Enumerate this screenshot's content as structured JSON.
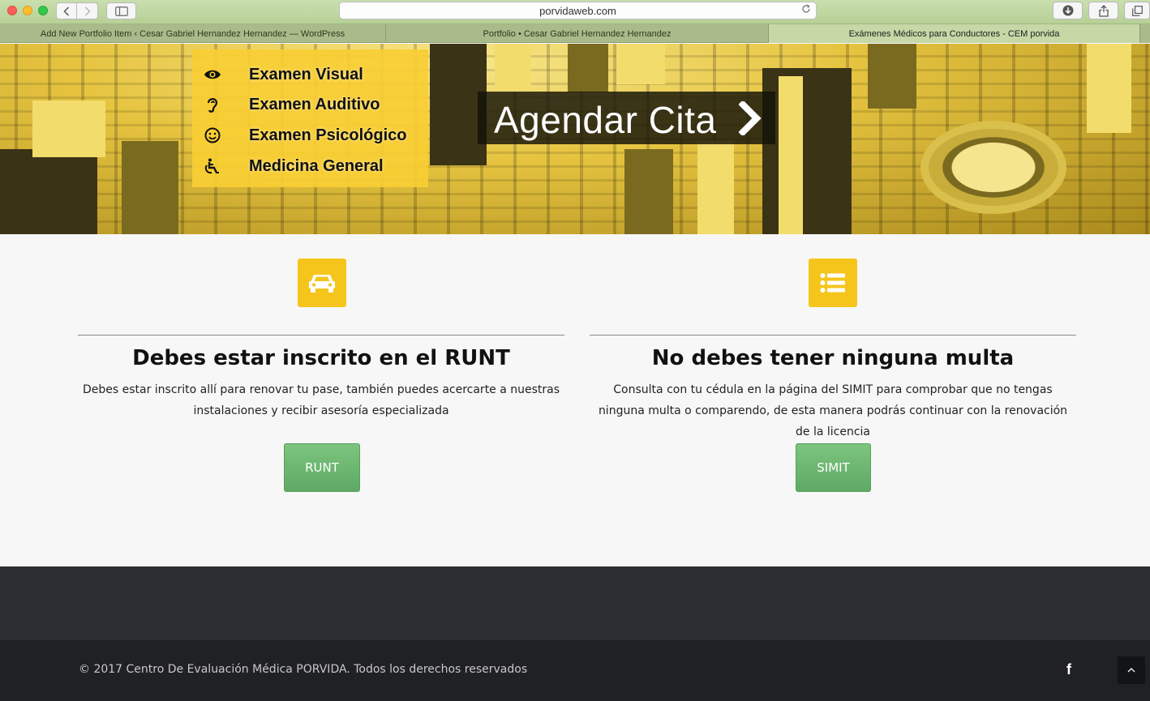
{
  "browser": {
    "url": "porvidaweb.com",
    "tabs": [
      {
        "title": "Add New Portfolio Item ‹ Cesar Gabriel Hernandez Hernandez — WordPress",
        "active": false
      },
      {
        "title": "Portfolio • Cesar Gabriel Hernandez Hernandez",
        "active": false
      },
      {
        "title": "Exámenes Médicos para Conductores - CEM porvida",
        "active": true
      }
    ]
  },
  "hero": {
    "menu": [
      {
        "label": "Examen Visual",
        "icon": "eye-icon"
      },
      {
        "label": "Examen Auditivo",
        "icon": "ear-icon"
      },
      {
        "label": "Examen Psicológico",
        "icon": "smile-icon"
      },
      {
        "label": "Medicina General",
        "icon": "wheelchair-icon"
      }
    ],
    "cta_label": "Agendar Cita"
  },
  "features": [
    {
      "icon": "car-icon",
      "title": "Debes estar inscrito en el RUNT",
      "description": "Debes estar inscrito allí para renovar tu pase, también puedes acercarte a nuestras instalaciones y recibir asesoría especializada",
      "button": "RUNT"
    },
    {
      "icon": "list-icon",
      "title": "No debes tener ninguna multa",
      "description": "Consulta con tu cédula en la página del SIMIT para comprobar que no tengas ninguna multa o comparendo, de esta manera podrás continuar con la renovación de la licencia",
      "button": "SIMIT"
    }
  ],
  "footer": {
    "copyright": "© 2017 Centro De Evaluación Médica PORVIDA. Todos los derechos reservados",
    "social": "f"
  },
  "colors": {
    "accent_yellow": "#f5c51b",
    "button_green": "#6bb56f",
    "footer_dark": "#202124"
  }
}
